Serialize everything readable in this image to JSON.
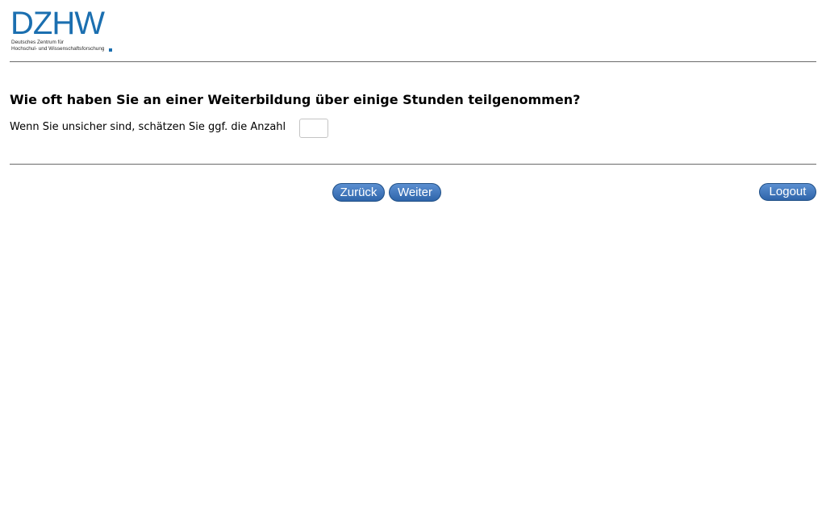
{
  "logo": {
    "wordmark": "DZHW",
    "subtitle_line1": "Deutsches Zentrum für",
    "subtitle_line2": "Hochschul- und Wissenschaftsforschung"
  },
  "question": {
    "text": "Wie oft haben Sie an einer Weiterbildung über einige Stunden teilgenommen?",
    "hint": "Wenn Sie unsicher sind, schätzen Sie ggf. die Anzahl",
    "input_value": ""
  },
  "navigation": {
    "back_label": "Zurück",
    "next_label": "Weiter",
    "logout_label": "Logout"
  },
  "colors": {
    "brand": "#1b6fb0",
    "button": "#3a6fb4"
  }
}
